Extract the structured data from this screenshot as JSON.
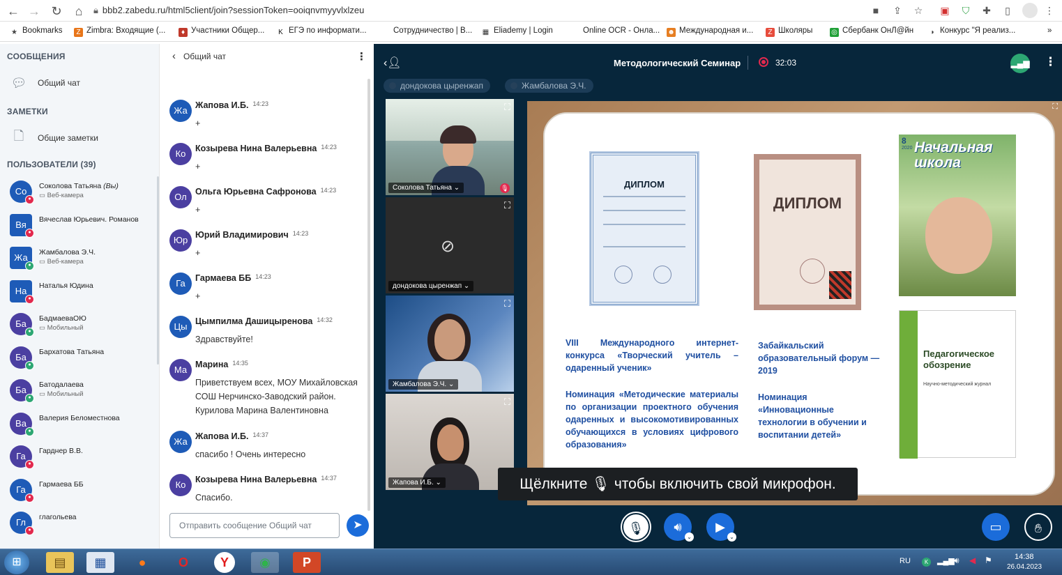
{
  "browser": {
    "url": "bbb2.zabedu.ru/html5client/join?sessionToken=ooiqnvmyyvlxlzeu",
    "bookmarks": [
      {
        "label": "Bookmarks",
        "color": "#444",
        "glyph": "★"
      },
      {
        "label": "Zimbra: Входящие (...",
        "color": "#e8761a",
        "glyph": "Z"
      },
      {
        "label": "Участники Общер...",
        "color": "#c0392b",
        "glyph": "♦"
      },
      {
        "label": "ЕГЭ по информати...",
        "color": "#111",
        "glyph": "K"
      },
      {
        "label": "Сотрудничество | В...",
        "color": "#fff",
        "glyph": ""
      },
      {
        "label": "Eliademy | Login",
        "color": "#333",
        "glyph": "▦"
      },
      {
        "label": "Online OCR - Онла...",
        "color": "#fff",
        "glyph": ""
      },
      {
        "label": "Международная и...",
        "color": "#e67e22",
        "glyph": "☻"
      },
      {
        "label": "Школяры",
        "color": "#e74c3c",
        "glyph": "Z"
      },
      {
        "label": "Сбербанк ОнЛ@йн",
        "color": "#21a038",
        "glyph": "◎"
      },
      {
        "label": "Конкурс \"Я реализ...",
        "color": "#333",
        "glyph": "◑"
      }
    ],
    "more": "»"
  },
  "sidebar": {
    "messages_title": "СООБЩЕНИЯ",
    "public_chat": "Общий чат",
    "notes_title": "ЗАМЕТКИ",
    "shared_notes": "Общие заметки",
    "users_title": "ПОЛЬЗОВАТЕЛИ (39)",
    "users": [
      {
        "initials": "Со",
        "name": "Соколова Татьяна",
        "you": "(Вы)",
        "sub": "Веб-камера",
        "color": "#1e5bb7",
        "badge": "red",
        "square": false
      },
      {
        "initials": "Вя",
        "name": "Вячеслав Юрьевич. Романов",
        "you": "",
        "sub": "",
        "color": "#1e5bb7",
        "badge": "red",
        "square": true
      },
      {
        "initials": "Жа",
        "name": "Жамбалова Э.Ч.",
        "you": "",
        "sub": "Веб-камера",
        "color": "#1e5bb7",
        "badge": "green",
        "square": true
      },
      {
        "initials": "На",
        "name": "Наталья Юдина",
        "you": "",
        "sub": "",
        "color": "#1e5bb7",
        "badge": "red",
        "square": true
      },
      {
        "initials": "Ба",
        "name": "БадмаеваОЮ",
        "you": "",
        "sub": "Мобильный",
        "color": "#4b3fa1",
        "badge": "green",
        "square": false
      },
      {
        "initials": "Ба",
        "name": "Бархатова Татьяна",
        "you": "",
        "sub": "",
        "color": "#4b3fa1",
        "badge": "green",
        "square": false
      },
      {
        "initials": "Ба",
        "name": "Батодалаева",
        "you": "",
        "sub": "Мобильный",
        "color": "#4b3fa1",
        "badge": "green",
        "square": false
      },
      {
        "initials": "Ва",
        "name": "Валерия Беломестнова",
        "you": "",
        "sub": "",
        "color": "#4b3fa1",
        "badge": "green",
        "square": false
      },
      {
        "initials": "Га",
        "name": "Гарднер В.В.",
        "you": "",
        "sub": "",
        "color": "#4b3fa1",
        "badge": "red",
        "square": false
      },
      {
        "initials": "Га",
        "name": "Гармаева ББ",
        "you": "",
        "sub": "",
        "color": "#1e5bb7",
        "badge": "red",
        "square": false
      },
      {
        "initials": "Гл",
        "name": "глагольева",
        "you": "",
        "sub": "",
        "color": "#1e5bb7",
        "badge": "red",
        "square": false
      }
    ]
  },
  "chat": {
    "back": "‹",
    "title": "Общий чат",
    "messages": [
      {
        "initials": "Жа",
        "name": "Жапова И.Б.",
        "time": "14:23",
        "text": "+",
        "color": "#1e5bb7"
      },
      {
        "initials": "Ко",
        "name": "Козырева Нина Валерьевна",
        "time": "14:23",
        "text": "+",
        "color": "#4b3fa1"
      },
      {
        "initials": "Ол",
        "name": "Ольга Юрьевна Сафронова",
        "time": "14:23",
        "text": "+",
        "color": "#4b3fa1"
      },
      {
        "initials": "Юр",
        "name": "Юрий Владимирович",
        "time": "14:23",
        "text": "+",
        "color": "#4b3fa1"
      },
      {
        "initials": "Га",
        "name": "Гармаева ББ",
        "time": "14:23",
        "text": "+",
        "color": "#1e5bb7"
      },
      {
        "initials": "Цы",
        "name": "Цымпилма Дашицыренова",
        "time": "14:32",
        "text": "Здравствуйте!",
        "color": "#1e5bb7"
      },
      {
        "initials": "Ма",
        "name": "Марина",
        "time": "14:35",
        "text": "Приветствуем всех, МОУ Михайловская СОШ Нерчинско-Заводский район. Курилова Марина Валентиновна",
        "color": "#4b3fa1"
      },
      {
        "initials": "Жа",
        "name": "Жапова И.Б.",
        "time": "14:37",
        "text": "спасибо ! Очень интересно",
        "color": "#1e5bb7"
      },
      {
        "initials": "Ко",
        "name": "Козырева Нина Валерьевна",
        "time": "14:37",
        "text": "Спасибо.",
        "color": "#4b3fa1"
      }
    ],
    "input_placeholder": "Отправить сообщение Общий чат"
  },
  "meeting": {
    "title": "Методологический Семинар",
    "timer": "32:03",
    "talkers": [
      "дондокова цыренжап",
      "Жамбалова Э.Ч."
    ],
    "videos": [
      {
        "name": "Соколова Татьяна"
      },
      {
        "name": "дондокова цыренжап"
      },
      {
        "name": "Жамбалова Э.Ч."
      },
      {
        "name": "Жапова И.Б."
      }
    ],
    "slide": {
      "diploma1_title": "ДИПЛОМ",
      "diploma2_title": "ДИПЛОМ",
      "magazine1_title": "Начальная школа",
      "magazine1_issue": "8",
      "magazine1_year": "2020",
      "magazine2_title": "Педагогическое обозрение",
      "magazine2_sub": "Научно-методический журнал",
      "text1": "VIII Международного интернет-конкурса «Творческий учитель – одаренный ученик»",
      "text2": "Номинация «Методические материалы по организации проектного обучения одаренных и высокомотивированных обучающихся в условиях цифрового образования»",
      "text3": "Забайкальский образовательный форум — 2019",
      "text4": "Номинация «Инновационные технологии в обучении и воспитании детей»"
    },
    "mic_tip_before": "Щёлкните",
    "mic_tip_after": "чтобы включить свой микрофон."
  },
  "taskbar": {
    "lang": "RU",
    "time": "14:38",
    "date": "26.04.2023"
  },
  "colors": {
    "accent": "#1b6cda",
    "meeting_bg": "#07263b",
    "sidebar_bg": "#f3f6f9"
  }
}
